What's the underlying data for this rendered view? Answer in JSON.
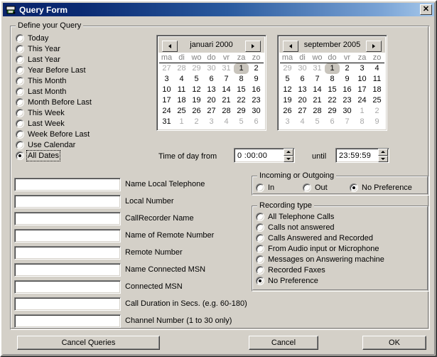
{
  "window": {
    "title": "Query Form",
    "icon": "call-recorder-icon",
    "close_label": "✕"
  },
  "define_group": {
    "title": "Define your Query",
    "date_options": [
      {
        "label": "Today",
        "selected": false
      },
      {
        "label": "This Year",
        "selected": false
      },
      {
        "label": "Last Year",
        "selected": false
      },
      {
        "label": "Year Before Last",
        "selected": false
      },
      {
        "label": "This Month",
        "selected": false
      },
      {
        "label": "Last Month",
        "selected": false
      },
      {
        "label": "Month Before Last",
        "selected": false
      },
      {
        "label": "This Week",
        "selected": false
      },
      {
        "label": "Last Week",
        "selected": false
      },
      {
        "label": "Week Before Last",
        "selected": false
      },
      {
        "label": "Use Calendar",
        "selected": false
      },
      {
        "label": "All Dates",
        "selected": true,
        "focused": true
      }
    ]
  },
  "calendars": [
    {
      "name": "start-calendar",
      "title": "januari 2000",
      "prev_label": "◄",
      "next_label": "►",
      "day_headers": [
        "ma",
        "di",
        "wo",
        "do",
        "vr",
        "za",
        "zo"
      ],
      "selected_day": 1,
      "weeks": [
        [
          {
            "d": 27,
            "dim": true
          },
          {
            "d": 28,
            "dim": true
          },
          {
            "d": 29,
            "dim": true
          },
          {
            "d": 30,
            "dim": true
          },
          {
            "d": 31,
            "dim": true
          },
          {
            "d": 1,
            "sel": true
          },
          {
            "d": 2
          }
        ],
        [
          {
            "d": 3
          },
          {
            "d": 4
          },
          {
            "d": 5
          },
          {
            "d": 6
          },
          {
            "d": 7
          },
          {
            "d": 8
          },
          {
            "d": 9
          }
        ],
        [
          {
            "d": 10
          },
          {
            "d": 11
          },
          {
            "d": 12
          },
          {
            "d": 13
          },
          {
            "d": 14
          },
          {
            "d": 15
          },
          {
            "d": 16
          }
        ],
        [
          {
            "d": 17
          },
          {
            "d": 18
          },
          {
            "d": 19
          },
          {
            "d": 20
          },
          {
            "d": 21
          },
          {
            "d": 22
          },
          {
            "d": 23
          }
        ],
        [
          {
            "d": 24
          },
          {
            "d": 25
          },
          {
            "d": 26
          },
          {
            "d": 27
          },
          {
            "d": 28
          },
          {
            "d": 29
          },
          {
            "d": 30
          }
        ],
        [
          {
            "d": 31
          },
          {
            "d": 1,
            "dim": true
          },
          {
            "d": 2,
            "dim": true
          },
          {
            "d": 3,
            "dim": true
          },
          {
            "d": 4,
            "dim": true
          },
          {
            "d": 5,
            "dim": true
          },
          {
            "d": 6,
            "dim": true
          }
        ]
      ]
    },
    {
      "name": "end-calendar",
      "title": "september 2005",
      "prev_label": "◄",
      "next_label": "►",
      "day_headers": [
        "ma",
        "di",
        "wo",
        "do",
        "vr",
        "za",
        "zo"
      ],
      "selected_day": 1,
      "weeks": [
        [
          {
            "d": 29,
            "dim": true
          },
          {
            "d": 30,
            "dim": true
          },
          {
            "d": 31,
            "dim": true
          },
          {
            "d": 1,
            "sel": true
          },
          {
            "d": 2
          },
          {
            "d": 3
          },
          {
            "d": 4
          }
        ],
        [
          {
            "d": 5
          },
          {
            "d": 6
          },
          {
            "d": 7
          },
          {
            "d": 8
          },
          {
            "d": 9
          },
          {
            "d": 10
          },
          {
            "d": 11
          }
        ],
        [
          {
            "d": 12
          },
          {
            "d": 13
          },
          {
            "d": 14
          },
          {
            "d": 15
          },
          {
            "d": 16
          },
          {
            "d": 17
          },
          {
            "d": 18
          }
        ],
        [
          {
            "d": 19
          },
          {
            "d": 20
          },
          {
            "d": 21
          },
          {
            "d": 22
          },
          {
            "d": 23
          },
          {
            "d": 24
          },
          {
            "d": 25
          }
        ],
        [
          {
            "d": 26
          },
          {
            "d": 27
          },
          {
            "d": 28
          },
          {
            "d": 29
          },
          {
            "d": 30
          },
          {
            "d": 1,
            "dim": true
          },
          {
            "d": 2,
            "dim": true
          }
        ],
        [
          {
            "d": 3,
            "dim": true
          },
          {
            "d": 4,
            "dim": true
          },
          {
            "d": 5,
            "dim": true
          },
          {
            "d": 6,
            "dim": true
          },
          {
            "d": 7,
            "dim": true
          },
          {
            "d": 8,
            "dim": true
          },
          {
            "d": 9,
            "dim": true
          }
        ]
      ]
    }
  ],
  "time_row": {
    "from_label": "Time of day from",
    "from_value": "0 :00:00",
    "until_label": "until",
    "until_value": "23:59:59",
    "spin_up": "▲",
    "spin_down": "▼"
  },
  "fields": [
    {
      "label": "Name Local Telephone",
      "value": "",
      "name": "name-local-telephone-input"
    },
    {
      "label": "Local Number",
      "value": "",
      "name": "local-number-input"
    },
    {
      "label": "CallRecorder Name",
      "value": "",
      "name": "callrecorder-name-input"
    },
    {
      "label": "Name of Remote Number",
      "value": "",
      "name": "name-of-remote-number-input"
    },
    {
      "label": "Remote Number",
      "value": "",
      "name": "remote-number-input"
    },
    {
      "label": "Name Connected MSN",
      "value": "",
      "name": "name-connected-msn-input"
    },
    {
      "label": "Connected MSN",
      "value": "",
      "name": "connected-msn-input"
    },
    {
      "label": "Call Duration in Secs. (e.g. 60-180)",
      "value": "",
      "name": "call-duration-input"
    },
    {
      "label": "Channel Number (1 to 30 only)",
      "value": "",
      "name": "channel-number-input"
    }
  ],
  "direction_group": {
    "title": "Incoming or Outgoing",
    "options": [
      {
        "label": "In",
        "selected": false
      },
      {
        "label": "Out",
        "selected": false
      },
      {
        "label": "No Preference",
        "selected": true
      }
    ]
  },
  "recording_group": {
    "title": "Recording type",
    "options": [
      {
        "label": "All Telephone Calls",
        "selected": false
      },
      {
        "label": "Calls not answered",
        "selected": false
      },
      {
        "label": "Calls Answered and Recorded",
        "selected": false
      },
      {
        "label": "From Audio input or Microphone",
        "selected": false
      },
      {
        "label": "Messages on Answering machine",
        "selected": false
      },
      {
        "label": "Recorded Faxes",
        "selected": false
      },
      {
        "label": "No Preference",
        "selected": true
      }
    ]
  },
  "buttons": {
    "cancel_queries": "Cancel Queries",
    "cancel": "Cancel",
    "ok": "OK"
  }
}
